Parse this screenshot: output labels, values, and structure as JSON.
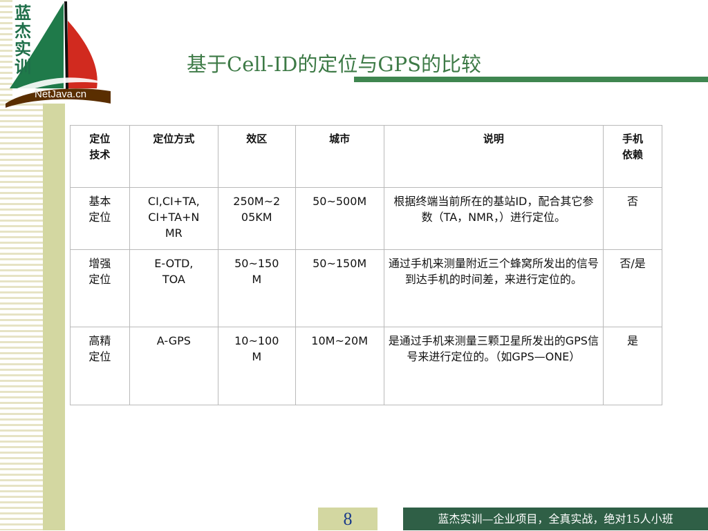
{
  "logo": {
    "vertical_text": [
      "蓝",
      "杰",
      "实",
      "训"
    ],
    "url": "NetJava.cn",
    "colors": {
      "sail_green": "#1f7a4a",
      "sail_red": "#d12a1f",
      "sail_black": "#111111"
    }
  },
  "title": "基于Cell-ID的定位与GPS的比较",
  "table": {
    "headers": [
      "定位\n技术",
      "定位方式",
      "效区",
      "城市",
      "说明",
      "手机\n依赖"
    ],
    "rows": [
      [
        "基本\n定位",
        "CI,CI+TA,\nCI+TA+N\nMR",
        "250M~2\n05KM",
        "50~500M",
        "根据终端当前所在的基站ID，配合其它参数（TA，NMR，）进行定位。",
        "否"
      ],
      [
        "增强\n定位",
        "E-OTD,\nTOA",
        "50~150\nM",
        "50~150M",
        "通过手机来测量附近三个蜂窝所发出的信号到达手机的时间差，来进行定位的。",
        "否/是"
      ],
      [
        "高精\n定位",
        "A-GPS",
        "10~100\nM",
        "10M~20M",
        "是通过手机来测量三颗卫星所发出的GPS信号来进行定位的。（如GPS—ONE）",
        "是"
      ]
    ]
  },
  "page_number": "8",
  "footer": "蓝杰实训—企业项目，全真实战，绝对15人小班",
  "colors": {
    "title_green": "#3d7a46",
    "band_green": "#d3d7a1",
    "footer_bg": "#2f5f46"
  }
}
